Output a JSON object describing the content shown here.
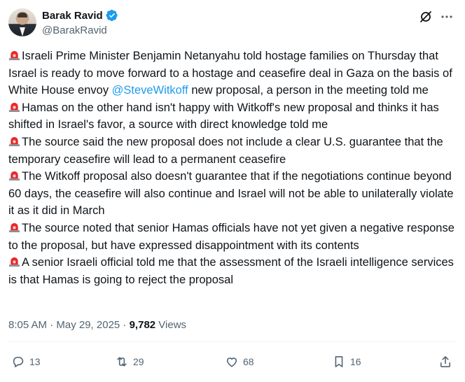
{
  "author": {
    "name": "Barak Ravid",
    "handle": "@BarakRavid",
    "verified": true
  },
  "tweet": {
    "paragraphs": [
      {
        "text": "Israeli Prime Minister Benjamin Netanyahu told hostage families on Thursday that Israel is ready to move forward to a hostage and ceasefire deal in Gaza on the basis of White House envoy ",
        "mention": "@SteveWitkoff",
        "after": " new proposal, a person in the meeting told me"
      },
      {
        "text": "Hamas on the other hand isn't happy with Witkoff's new proposal and thinks it has shifted in Israel's favor, a source with direct knowledge told me"
      },
      {
        "text": "The source said the new proposal does not include a clear U.S. guarantee that the temporary ceasefire will lead to a permanent ceasefire"
      },
      {
        "text": "The Witkoff proposal also doesn't guarantee that if the negotiations continue beyond 60 days, the ceasefire will also continue and Israel will not be able to unilaterally violate it as it did in March"
      },
      {
        "text": "The source noted that senior Hamas officials have not yet given a negative response to the proposal, but have expressed disappointment with its contents"
      },
      {
        "text": "A senior Israeli official told me that the assessment of the Israeli intelligence services is that Hamas is going to reject the proposal"
      }
    ],
    "timestamp": "8:05 AM · May 29, 2025 · ",
    "views_count": "9,782",
    "views_label": " Views"
  },
  "actions": {
    "replies": "13",
    "reposts": "29",
    "likes": "68",
    "bookmarks": "16"
  },
  "icons": {
    "paragraph_marker": "police-siren-emoji",
    "grok": "grok-icon",
    "more": "more-icon"
  },
  "colors": {
    "accent": "#1d9bf0",
    "secondary_text": "#536471",
    "primary_text": "#0f1419",
    "siren_red": "#e8282b"
  }
}
